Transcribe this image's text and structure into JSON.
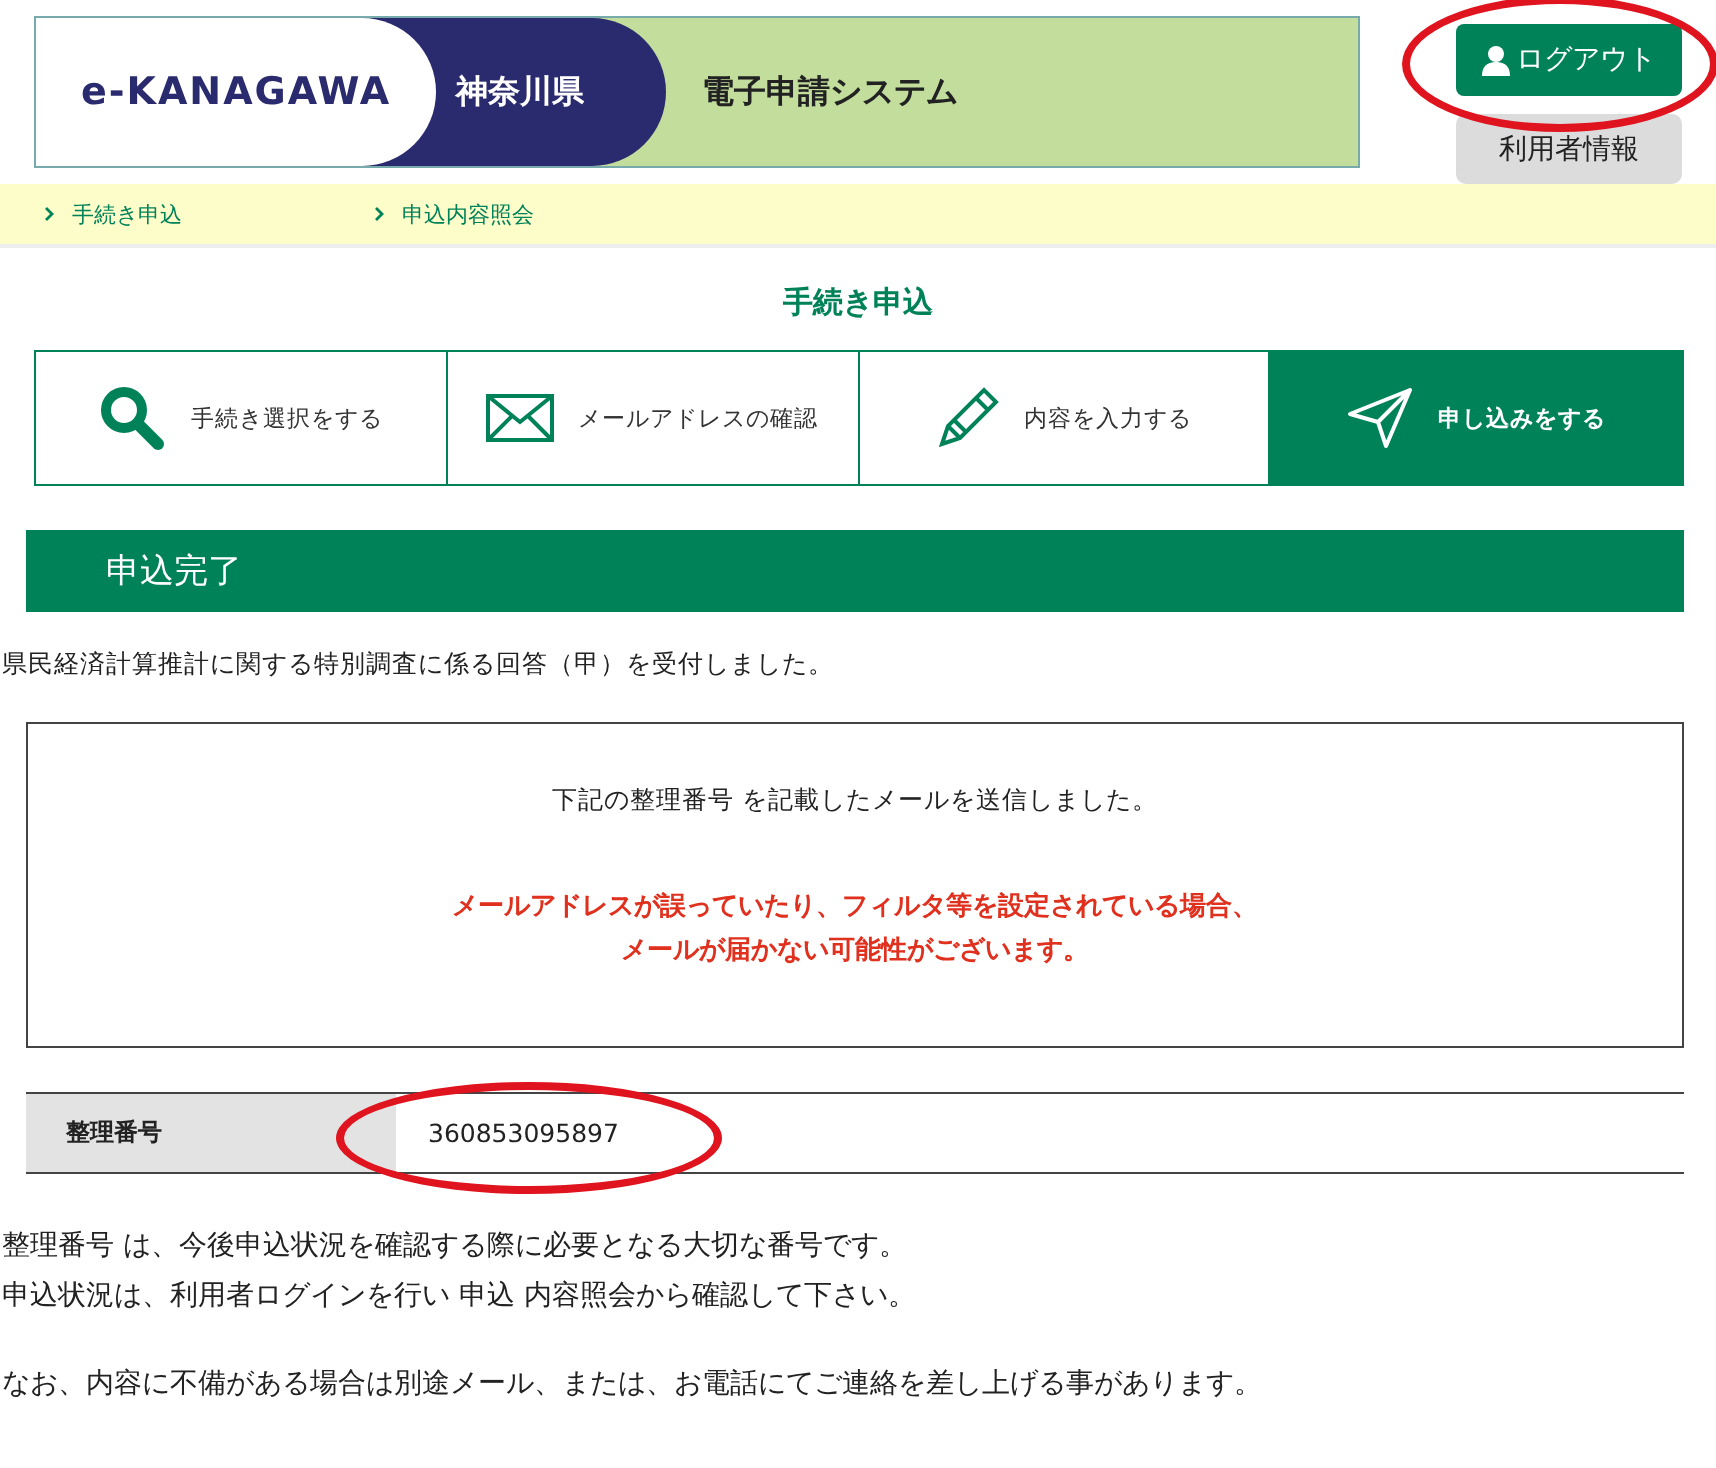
{
  "header": {
    "logo": "e-KANAGAWA",
    "prefecture": "神奈川県",
    "system_title": "電子申請システム",
    "logout_button": {
      "label": "ログアウト",
      "highlighted": true
    },
    "user_info_button": "利用者情報"
  },
  "breadcrumb": [
    "手続き申込",
    "申込内容照会"
  ],
  "page_title": "手続き申込",
  "steps": [
    {
      "kind": "search",
      "label": "手続き選択をする",
      "selected": false
    },
    {
      "kind": "mail",
      "label": "メールアドレスの確認",
      "selected": false
    },
    {
      "kind": "pencil",
      "label": "内容を入力する",
      "selected": false
    },
    {
      "kind": "send",
      "label": "申し込みをする",
      "selected": true
    }
  ],
  "section_title": "申込完了",
  "received_message": "県民経済計算推計に関する特別調査に係る回答（甲）を受付しました。",
  "notice_box": {
    "message": "下記の整理番号 を記載したメールを送信しました。",
    "warning_lines": [
      "メールアドレスが誤っていたり、フィルタ等を設定されている場合、",
      "メールが届かない可能性がございます。"
    ]
  },
  "reference": {
    "label": "整理番号",
    "value": "360853095897",
    "highlighted": true
  },
  "notes": [
    "整理番号 は、今後申込状況を確認する際に必要となる大切な番号です。",
    "申込状況は、利用者ログインを行い 申込 内容照会から確認して下さい。"
  ],
  "footer_note": "なお、内容に不備がある場合は別途メール、または、お電話にてご連絡を差し上げる事があります。"
}
